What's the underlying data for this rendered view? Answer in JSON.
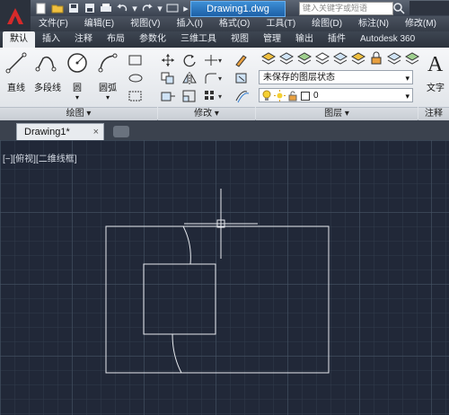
{
  "title_bar": {
    "document_title": "Drawing1.dwg",
    "search_placeholder": "键入关键字或短语"
  },
  "menu": [
    "文件(F)",
    "编辑(E)",
    "视图(V)",
    "插入(I)",
    "格式(O)",
    "工具(T)",
    "绘图(D)",
    "标注(N)",
    "修改(M)"
  ],
  "ribbon_tabs": [
    "默认",
    "插入",
    "注释",
    "布局",
    "参数化",
    "三维工具",
    "视图",
    "管理",
    "输出",
    "插件",
    "Autodesk 360"
  ],
  "ribbon": {
    "draw_tools": [
      "直线",
      "多段线",
      "圆",
      "圆弧"
    ],
    "text_tool": "文字",
    "panels": [
      "绘图 ▾",
      "修改 ▾",
      "图层 ▾",
      "注释"
    ],
    "layer_state": "未保存的图层状态",
    "current_layer": "0"
  },
  "doc_tabs": {
    "active": "Drawing1*",
    "close_glyph": "×"
  },
  "viewport": {
    "label": "[−][俯视][二维线框]"
  },
  "colors": {
    "canvas_bg": "#212838",
    "accent": "#2e7bcf",
    "linework": "#e6e9ee"
  }
}
